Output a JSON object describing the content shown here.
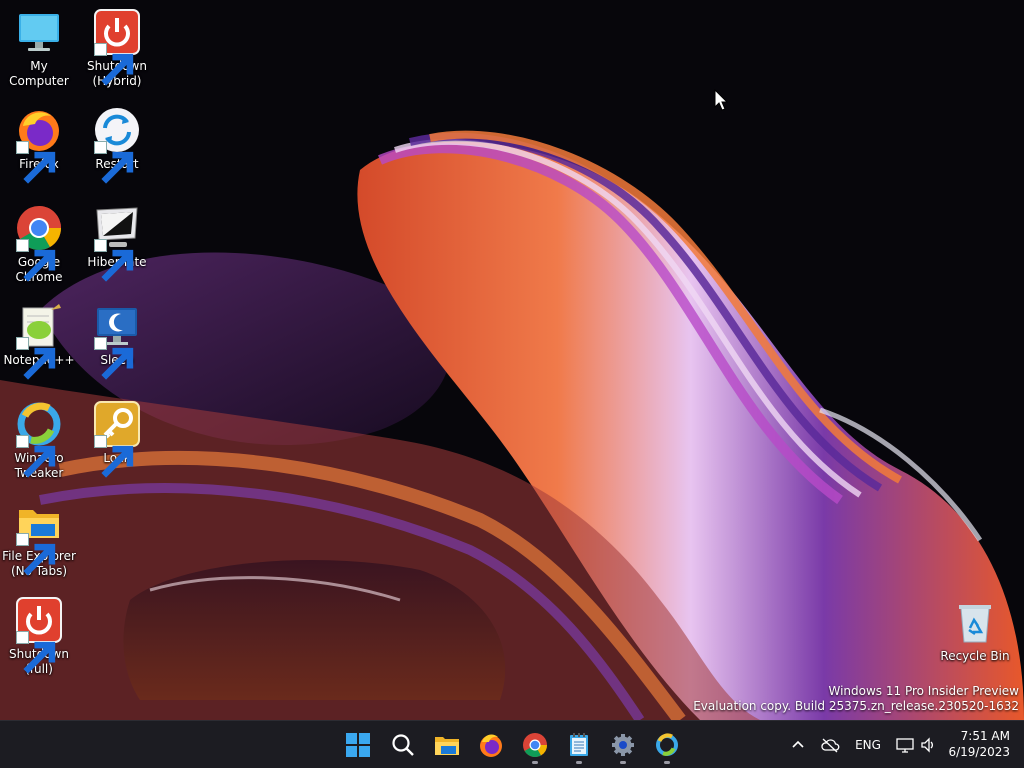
{
  "desktop": {
    "icons": [
      {
        "label": "My Computer",
        "icon": "monitor-icon"
      },
      {
        "label": "Shutdown\n(Hybrid)",
        "icon": "power-icon"
      },
      {
        "label": "Firefox",
        "icon": "firefox-icon"
      },
      {
        "label": "Restart",
        "icon": "restart-icon"
      },
      {
        "label": "Google\nChrome",
        "icon": "chrome-icon"
      },
      {
        "label": "Hibernate",
        "icon": "hibernate-icon"
      },
      {
        "label": "Notepad++",
        "icon": "notepadpp-icon"
      },
      {
        "label": "Sleep",
        "icon": "sleep-icon"
      },
      {
        "label": "Winaero\nTweaker",
        "icon": "winaero-icon"
      },
      {
        "label": "Lock",
        "icon": "lock-key-icon"
      },
      {
        "label": "File Explorer\n(No Tabs)",
        "icon": "folder-icon"
      },
      {
        "label": "Shutdown\n(full)",
        "icon": "power-icon"
      },
      {
        "label": "Recycle Bin",
        "icon": "recycle-bin-icon"
      }
    ],
    "watermark": {
      "line1": "Windows 11 Pro Insider Preview",
      "line2": "Evaluation copy. Build 25375.zn_release.230520-1632"
    }
  },
  "taskbar": {
    "apps": [
      "start-icon",
      "search-icon",
      "file-explorer-icon",
      "firefox-icon",
      "chrome-icon",
      "notepad-icon",
      "settings-icon",
      "winaero-icon"
    ],
    "tray": {
      "language": "ENG",
      "time": "7:51 AM",
      "date": "6/19/2023"
    }
  },
  "colors": {
    "taskbar_bg": "#1c1c22",
    "accent": "#0078d4",
    "shutdown_red": "#e0402e",
    "lock_gold": "#e0a82a"
  }
}
